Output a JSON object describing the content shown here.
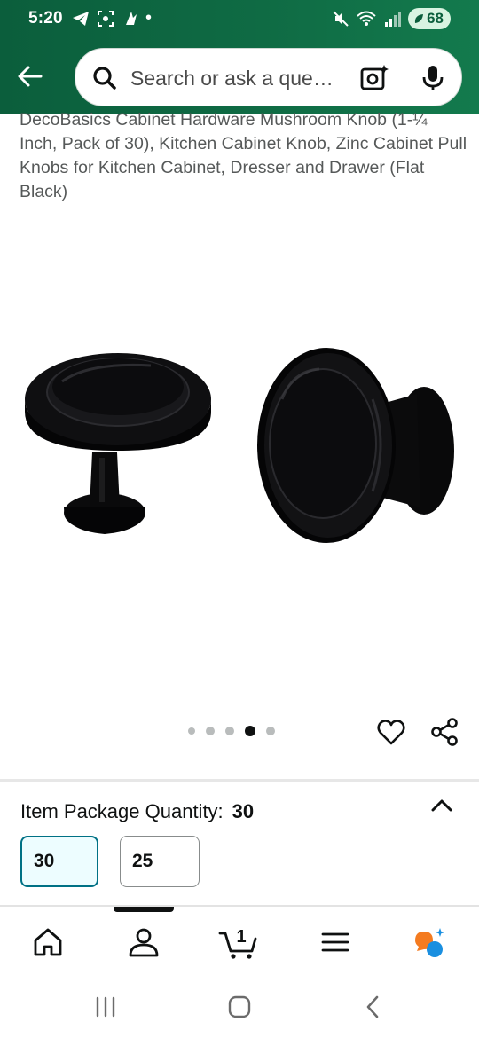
{
  "status_bar": {
    "time": "5:20",
    "battery": "68",
    "notification_dot": "•"
  },
  "search": {
    "placeholder": "Search or ask a question"
  },
  "product": {
    "title": "DecoBasics Cabinet Hardware Mushroom Knob (1-¼ Inch, Pack of 30), Kitchen Cabinet Knob, Zinc Cabinet Pull Knobs for Kitchen Cabinet, Dresser and Drawer (Flat Black)",
    "image_alt": "black-mushroom-knobs",
    "carousel": {
      "count": 5,
      "active_index": 3
    }
  },
  "quantity": {
    "label": "Item Package Quantity:",
    "value": "30",
    "options": [
      {
        "label": "30",
        "selected": true
      },
      {
        "label": "25",
        "selected": false
      }
    ]
  },
  "bottom_nav": {
    "items": [
      {
        "icon": "home-icon"
      },
      {
        "icon": "account-icon"
      },
      {
        "icon": "cart-icon",
        "badge": "1"
      },
      {
        "icon": "menu-icon"
      },
      {
        "icon": "rufus-icon"
      }
    ]
  },
  "colors": {
    "header": "#0f6b44",
    "selected_border": "#007185",
    "selected_bg": "#edfdff",
    "rufus_orange": "#f47b20",
    "rufus_blue": "#1a8fe0"
  }
}
